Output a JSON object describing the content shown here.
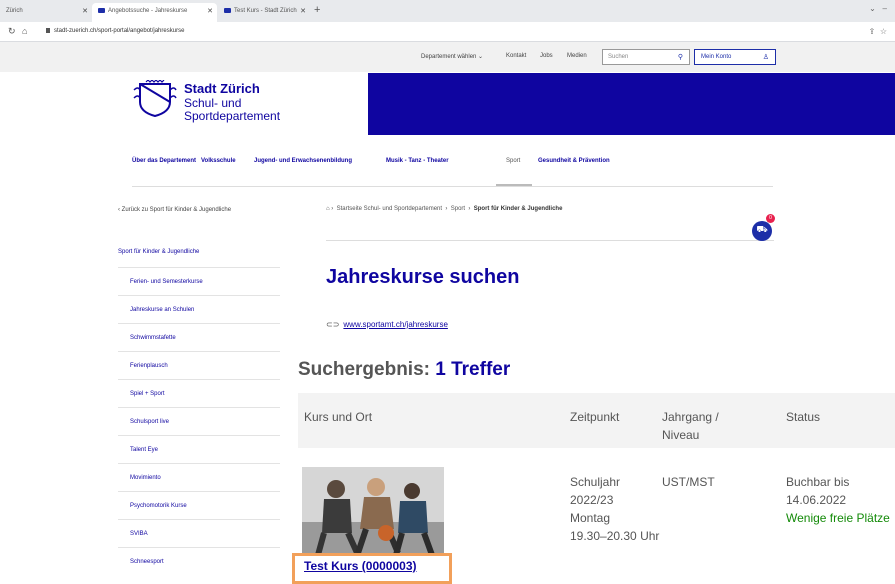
{
  "browser": {
    "tabs": [
      {
        "title": "Zürich",
        "active": false
      },
      {
        "title": "Angebotssuche - Jahreskurse",
        "active": true
      },
      {
        "title": "Test Kurs - Stadt Zürich",
        "active": false
      }
    ],
    "new_tab_label": "+",
    "url": "stadt-zuerich.ch/sport-portal/angebot/jahreskurse"
  },
  "utility_nav": {
    "departement": "Departement wählen ⌄",
    "kontakt": "Kontakt",
    "jobs": "Jobs",
    "medien": "Medien",
    "search_placeholder": "Suchen",
    "account": "Mein Konto"
  },
  "brand": {
    "org": "Stadt Zürich",
    "dept_line1": "Schul- und",
    "dept_line2": "Sportdepartement",
    "color": "#0f05a0"
  },
  "main_nav": [
    "Über das Departement",
    "Volksschule",
    "Jugend- und Erwachsenenbildung",
    "Musik - Tanz - Theater",
    "Sport",
    "Gesundheit & Prävention"
  ],
  "back_link": "‹  Zurück zu Sport für Kinder & Jugendliche",
  "breadcrumb": {
    "home": "⌂",
    "sep": "›",
    "item1": "Startseite Schul- und Sportdepartement",
    "item2": "Sport",
    "current": "Sport für Kinder & Jugendliche"
  },
  "cart": {
    "count": "0"
  },
  "sidebar": {
    "title": "Sport für Kinder & Jugendliche",
    "items": [
      "Ferien- und Semesterkurse",
      "Jahreskurse an Schulen",
      "Schwimmstafette",
      "Ferienplausch",
      "Spiel + Sport",
      "Schulsport live",
      "Talent Eye",
      "Movimiento",
      "Psychomotorik Kurse",
      "SVIBA",
      "Schneesport"
    ]
  },
  "main": {
    "title": "Jahreskurse suchen",
    "link_text": "www.sportamt.ch/jahreskurse",
    "results_label": "Suchergebnis: ",
    "results_count": "1 Treffer",
    "table": {
      "headers": [
        "Kurs und Ort",
        "Zeitpunkt",
        "Jahrgang /",
        "Niveau",
        "Status"
      ],
      "row": {
        "course_name": "Test Kurs (0000003)",
        "zeit_1": "Schuljahr",
        "zeit_2": "2022/23",
        "zeit_3": "Montag",
        "zeit_4": "19.30–20.30 Uhr",
        "jahrgang": "UST/MST",
        "status_1": "Buchbar bis",
        "status_2": "14.06.2022",
        "status_3": "Wenige freie Plätze"
      }
    }
  }
}
